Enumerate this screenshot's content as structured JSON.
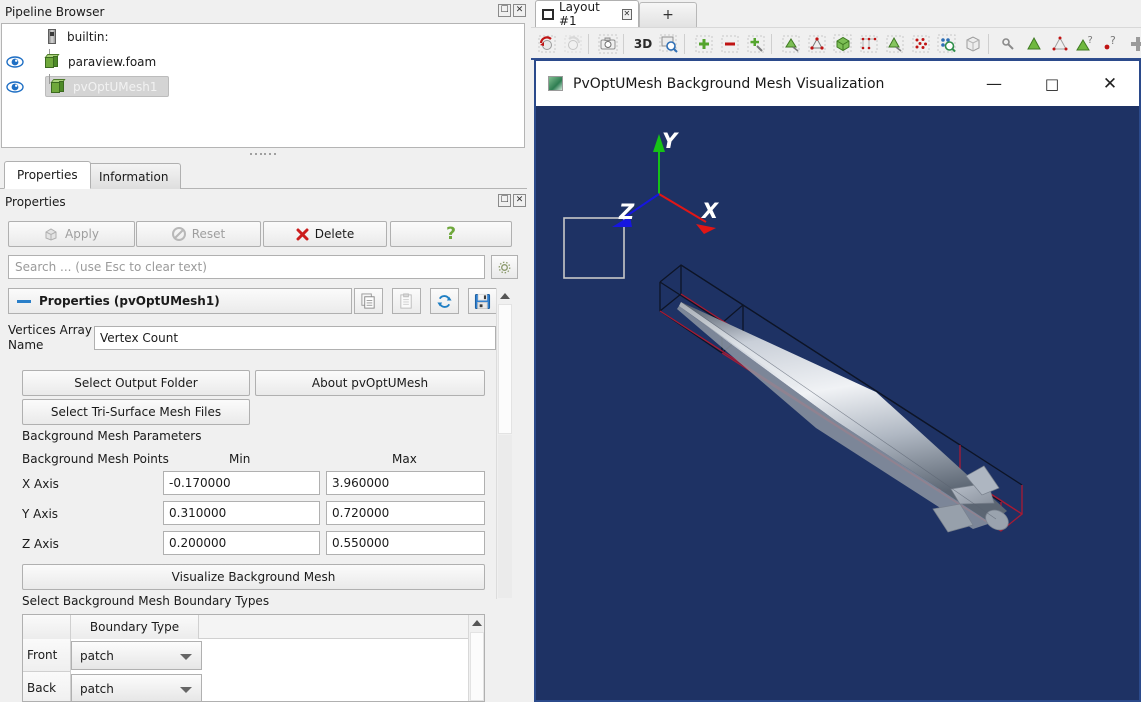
{
  "pipeline": {
    "dock_title": "Pipeline Browser",
    "dock_buttons": {
      "float": "float-icon",
      "close": "close-icon"
    },
    "items": [
      {
        "label": "builtin:",
        "icon": "server-icon",
        "visible": null,
        "selected": false
      },
      {
        "label": "paraview.foam",
        "icon": "cube-icon",
        "visible": true,
        "selected": false
      },
      {
        "label": "pvOptUMesh1",
        "icon": "cube-icon",
        "visible": true,
        "selected": true
      }
    ]
  },
  "panel_tabs": [
    {
      "label": "Properties",
      "active": true
    },
    {
      "label": "Information",
      "active": false
    }
  ],
  "properties": {
    "dock_title": "Properties",
    "buttons": {
      "apply": "Apply",
      "reset": "Reset",
      "delete": "Delete",
      "help": "?"
    },
    "search": {
      "placeholder": "Search ... (use Esc to clear text)",
      "value": ""
    },
    "gear_icon": "gear-icon",
    "group_header": "Properties (pvOptUMesh1)",
    "header_icons": [
      "copy-icon",
      "paste-icon",
      "restore-defaults-icon",
      "save-icon"
    ],
    "vertices_array_name": {
      "label": "Vertices Array Name",
      "value": "Vertex Count"
    },
    "action_buttons": {
      "select_output_folder": "Select Output Folder",
      "about": "About pvOptUMesh",
      "select_tri_surface": "Select Tri-Surface Mesh Files",
      "visualize": "Visualize Background Mesh"
    },
    "bg_mesh_params_label": "Background Mesh Parameters",
    "bg_mesh_points_label": "Background Mesh Points",
    "col_min": "Min",
    "col_max": "Max",
    "axes": [
      {
        "label": "X Axis",
        "min": "-0.170000",
        "max": "3.960000"
      },
      {
        "label": "Y Axis",
        "min": "0.310000",
        "max": "0.720000"
      },
      {
        "label": "Z Axis",
        "min": "0.200000",
        "max": "0.550000"
      }
    ],
    "boundary_section_label": "Select Background Mesh Boundary Types",
    "boundary_table": {
      "column_header": "Boundary Type",
      "rows": [
        {
          "name": "Front",
          "type": "patch"
        },
        {
          "name": "Back",
          "type": "patch"
        }
      ]
    }
  },
  "layout": {
    "tab_label": "Layout #1",
    "tab_icon": "layout-icon",
    "tab_close_icon": "close-icon",
    "add_tab_label": "+"
  },
  "toolbar": {
    "items": [
      "camera-undo-icon",
      "camera-redo-icon",
      "screenshot-icon",
      "3d-label",
      "zoom-to-box-icon",
      "add-point-icon",
      "remove-point-icon",
      "move-point-icon",
      "interactive-plane-icon",
      "polyline-source-icon",
      "box-source-icon",
      "spline-source-icon",
      "cone-source-icon",
      "point-cloud-icon",
      "probe-location-icon",
      "mesh-icon",
      "pick-point-icon",
      "hover-cells-icon",
      "select-points-icon",
      "cell-query-icon",
      "point-query-icon",
      "plus-icon"
    ],
    "3d_label": "3D"
  },
  "dialog": {
    "title": "PvOptUMesh Background Mesh Visualization",
    "icon": "app-icon",
    "minimize_label": "—",
    "maximize_label": "□",
    "close_label": "✕",
    "background_color": "#1e3264",
    "axes": [
      {
        "label": "X",
        "color": "#e01616"
      },
      {
        "label": "Y",
        "color": "#16c216"
      },
      {
        "label": "Z",
        "color": "#1616e0"
      }
    ],
    "scene": {
      "description": "Rocket/missile tri-surface geometry inside a wireframe background mesh bounding box",
      "surface_color": "#b8bfc9",
      "box_near_color": "#a81a33",
      "box_far_color": "#0d1426",
      "orientation_square_color": "#c8c8c8"
    }
  }
}
